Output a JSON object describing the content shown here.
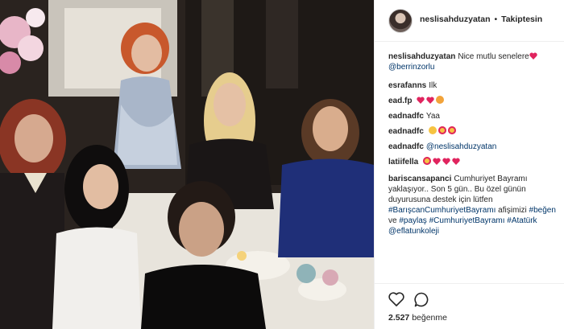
{
  "post": {
    "username": "neslisahduzyatan",
    "separator": "•",
    "follow_label": "Takiptesin",
    "likes_count": "2.527",
    "likes_label": "beğenme"
  },
  "comments": [
    {
      "user": "neslisahduzyatan",
      "text": "Nice mutlu senelere",
      "mention": "@berrinzorlu",
      "emoji": [
        "heart"
      ]
    },
    {
      "user": "esrafanns",
      "text": "Ilk"
    },
    {
      "user": "ead.fp",
      "text": "",
      "emoji": [
        "heart",
        "heart",
        "cat"
      ]
    },
    {
      "user": "eadnadfc",
      "text": "Yaa"
    },
    {
      "user": "eadnadfc",
      "text": "",
      "emoji": [
        "sad",
        "heart-eyes",
        "heart-eyes"
      ]
    },
    {
      "user": "eadnadfc",
      "text": "",
      "mention": "@neslisahduzyatan"
    },
    {
      "user": "latiifella",
      "text": "",
      "emoji": [
        "heart-eyes",
        "heart",
        "heart",
        "heart"
      ]
    },
    {
      "user": "bariscansapanci",
      "line1": "Cumhuriyet Bayramı",
      "line2": "yaklaşıyor.. Son 5 gün.. Bu özel günün",
      "line3": "duyurusuna destek için lütfen",
      "tag1": "#BarışcanCumhuriyetBayramı",
      "line4": "afişimizi",
      "tag2": "#beğen",
      "line5": "ve",
      "tag3": "#paylaş",
      "tag4": "#CumhuriyetBayramı",
      "tag5": "#Atatürk",
      "tag6": "@eflatunkoleji"
    }
  ],
  "icons": {
    "like": "heart-outline-icon",
    "comment": "comment-bubble-icon"
  },
  "colors": {
    "link": "#003569",
    "heart": "#ed4956",
    "text": "#262626",
    "border": "#efefef"
  }
}
